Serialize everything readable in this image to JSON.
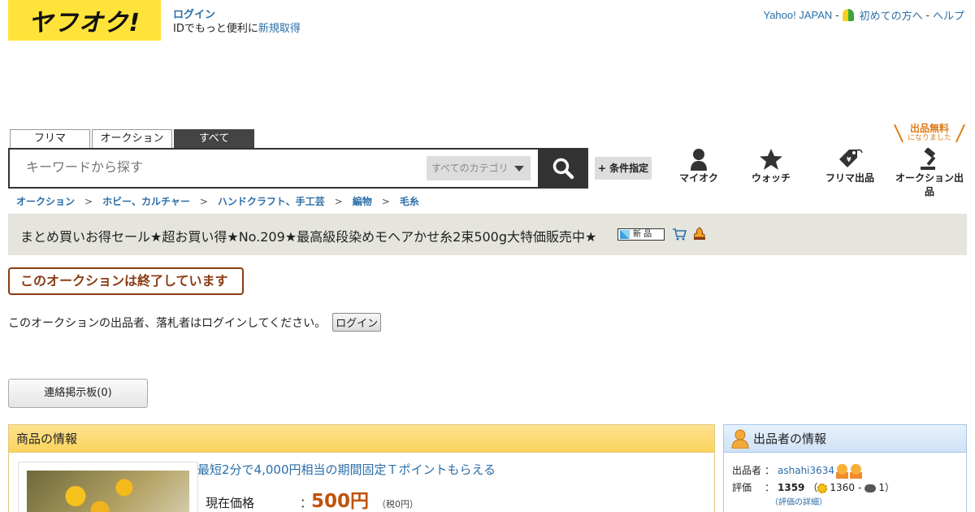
{
  "header": {
    "logo_text": "ヤフオク!",
    "login_label": "ログイン",
    "signup_prefix": "IDでもっと便利に",
    "signup_link": "新規取得",
    "yahoo_japan": "Yahoo! JAPAN",
    "separator": "-",
    "first_time": "初めての方へ",
    "help": "ヘルプ"
  },
  "search": {
    "tabs": [
      {
        "label": "フリマ",
        "active": false
      },
      {
        "label": "オークション",
        "active": false
      },
      {
        "label": "すべて",
        "active": true
      }
    ],
    "placeholder": "キーワードから探す",
    "category": "すべてのカテゴリ",
    "condition_button": "+ 条件指定"
  },
  "nav": {
    "free_badge": "出品無料",
    "free_badge_sub": "になりました",
    "items": [
      {
        "label": "マイオク",
        "icon": "person-icon"
      },
      {
        "label": "ウォッチ",
        "icon": "star-icon"
      },
      {
        "label": "フリマ出品",
        "icon": "price-tag-icon"
      },
      {
        "label": "オークション出品",
        "icon": "gavel-icon"
      }
    ]
  },
  "breadcrumb": {
    "items": [
      "オークション",
      "ホビー、カルチャー",
      "ハンドクラフト、手工芸",
      "編物",
      "毛糸"
    ],
    "separator": ">"
  },
  "item": {
    "title": "まとめ買いお得セール★超お買い得★No.209★最高級段染めモヘアかせ糸2束500g大特価販売中★",
    "new_badge": "新 品",
    "ended_notice": "このオークションは終了しています",
    "login_note": "このオークションの出品者、落札者はログインしてください。",
    "login_button": "ログイン",
    "board_button": "連絡掲示板(0)"
  },
  "product_info": {
    "heading": "商品の情報",
    "tpoint_link": "最短2分で4,000円相当の期間固定Ｔポイントもらえる",
    "price_label": "現在価格",
    "colon": "：",
    "price": "500円",
    "tax": "（税0円）"
  },
  "seller_info": {
    "heading": "出品者の情報",
    "seller_label": "出品者",
    "seller_name": "ashahi3634",
    "rating_label": "評価",
    "colon": "：",
    "rating_total": "1359",
    "rating_open": "（",
    "rating_good": "1360",
    "rating_dash": "-",
    "rating_bad": "1）",
    "detail_link": "（評価の詳細）"
  },
  "colors": {
    "brand_yellow": "#ffe33a",
    "link_blue": "#2b6ea8",
    "ended_brown": "#8a3c12",
    "price_orange": "#c0520b",
    "free_orange": "#e07b1a"
  }
}
